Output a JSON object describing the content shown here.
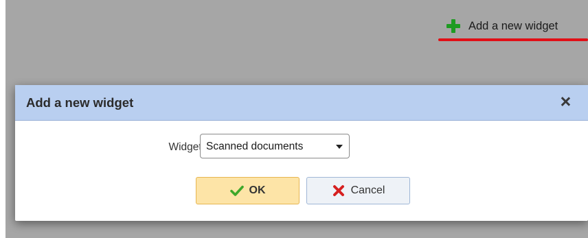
{
  "toolbar": {
    "add_widget_label": "Add a new widget",
    "add_widget_icon": "plus-icon",
    "plus_color": "#1e9b22",
    "highlight_color": "#e10f16"
  },
  "dialog": {
    "title": "Add a new widget",
    "close_icon": "close-icon",
    "header_color": "#b9cff0",
    "widget_label": "Widget:",
    "widget_select": {
      "selected": "Scanned documents"
    },
    "ok_button": {
      "label": "OK",
      "icon": "checkmark-icon"
    },
    "cancel_button": {
      "label": "Cancel",
      "icon": "red-x-icon"
    }
  }
}
